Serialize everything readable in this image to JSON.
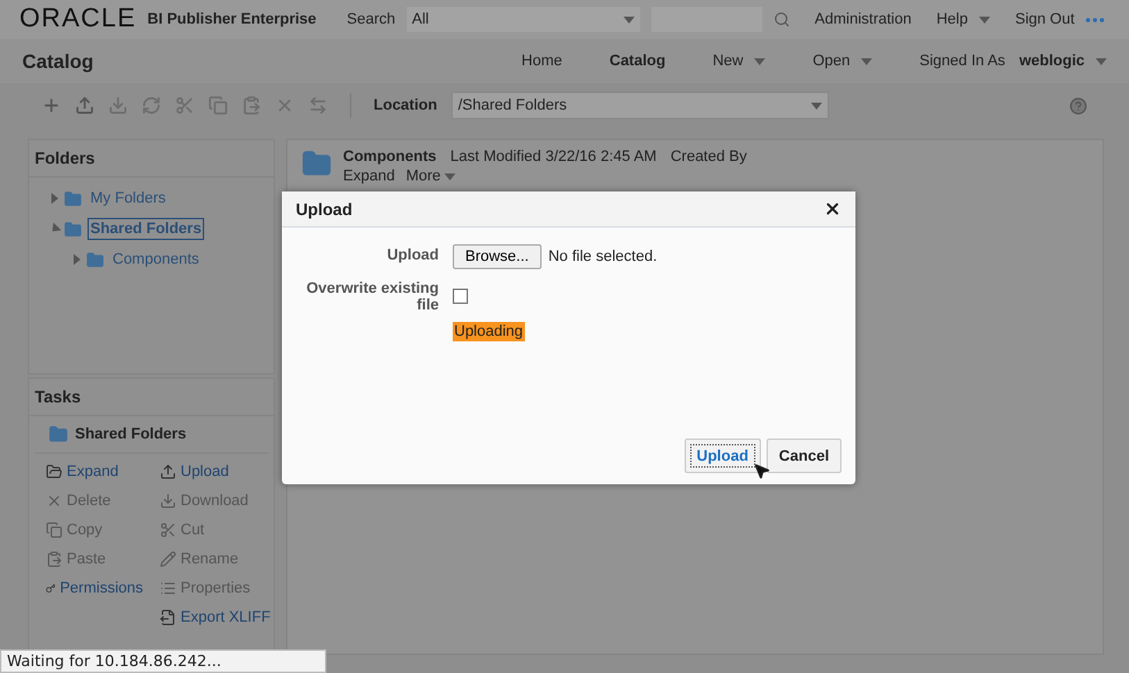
{
  "header": {
    "logo": "ORACLE",
    "product": "BI Publisher Enterprise",
    "search_label": "Search",
    "search_scope": "All",
    "links": [
      {
        "label": "Administration",
        "menu": false
      },
      {
        "label": "Help",
        "menu": true
      },
      {
        "label": "Sign Out",
        "menu": false
      }
    ]
  },
  "nav": {
    "title": "Catalog",
    "items": [
      {
        "label": "Home",
        "selected": false,
        "menu": false
      },
      {
        "label": "Catalog",
        "selected": true,
        "menu": false
      },
      {
        "label": "New",
        "selected": false,
        "menu": true
      },
      {
        "label": "Open",
        "selected": false,
        "menu": true
      }
    ],
    "signed_in_label": "Signed In As",
    "user": "weblogic"
  },
  "toolbar": {
    "location_label": "Location",
    "location": "/Shared Folders"
  },
  "folders": {
    "title": "Folders",
    "tree": [
      {
        "label": "My Folders",
        "expanded": false,
        "selected": false
      },
      {
        "label": "Shared Folders",
        "expanded": true,
        "selected": true,
        "children": [
          {
            "label": "Components",
            "expanded": false,
            "selected": false
          }
        ]
      }
    ]
  },
  "content": {
    "name": "Components",
    "modified": "Last Modified 3/22/16 2:45 AM",
    "created": "Created By",
    "actions": [
      {
        "label": "Expand",
        "menu": false
      },
      {
        "label": "More",
        "menu": true
      }
    ]
  },
  "tasks": {
    "title": "Tasks",
    "folder": "Shared Folders",
    "columns": [
      [
        {
          "kind": "expand",
          "label": "Expand",
          "disabled": false
        },
        {
          "kind": "delete",
          "label": "Delete",
          "disabled": true
        },
        {
          "kind": "copy",
          "label": "Copy",
          "disabled": true
        },
        {
          "kind": "paste",
          "label": "Paste",
          "disabled": true
        },
        {
          "kind": "permissions",
          "label": "Permissions",
          "disabled": false
        }
      ],
      [
        {
          "kind": "upload",
          "label": "Upload",
          "disabled": false
        },
        {
          "kind": "download",
          "label": "Download",
          "disabled": true
        },
        {
          "kind": "cut",
          "label": "Cut",
          "disabled": true
        },
        {
          "kind": "rename",
          "label": "Rename",
          "disabled": true
        },
        {
          "kind": "properties",
          "label": "Properties",
          "disabled": true
        },
        {
          "kind": "export",
          "label": "Export XLIFF",
          "disabled": false
        }
      ]
    ]
  },
  "dialog": {
    "title": "Upload",
    "upload_label": "Upload",
    "browse": "Browse...",
    "file_status": "No file selected.",
    "overwrite_label": "Overwrite existing file",
    "overwrite_checked": false,
    "progress": "Uploading",
    "buttons": [
      {
        "label": "Upload",
        "focused": true
      },
      {
        "label": "Cancel",
        "focused": false
      }
    ]
  },
  "status_bar": "Waiting for 10.184.86.242..."
}
